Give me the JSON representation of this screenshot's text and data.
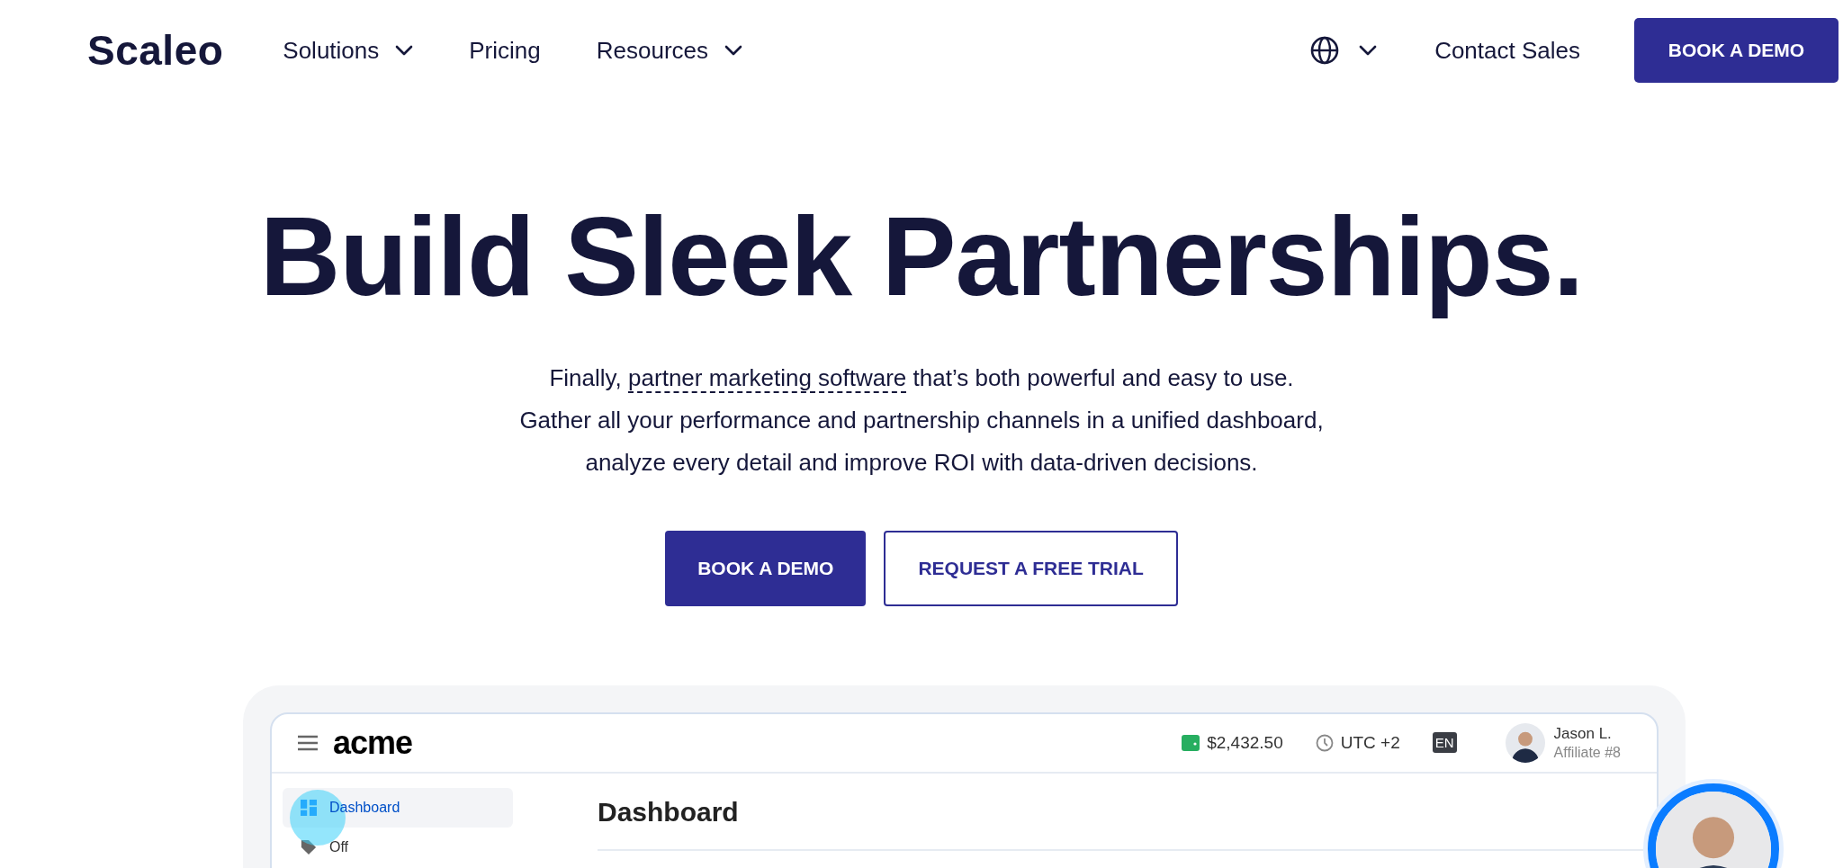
{
  "header": {
    "logo": "Scaleo",
    "nav": [
      {
        "label": "Solutions",
        "dropdown": true
      },
      {
        "label": "Pricing",
        "dropdown": false
      },
      {
        "label": "Resources",
        "dropdown": true
      }
    ],
    "contact": "Contact Sales",
    "cta": "BOOK A DEMO"
  },
  "hero": {
    "title": "Build Sleek Partnerships.",
    "subtitle": {
      "lead": "Finally, ",
      "link": "partner marketing software",
      "rest": " that’s both powerful and easy to use.",
      "lines": [
        "Gather all your performance and partnership channels in a unified dashboard,",
        "analyze every detail and improve ROI with data-driven decisions."
      ]
    },
    "buttons": [
      {
        "label": "BOOK A DEMO",
        "kind": "primary"
      },
      {
        "label": "REQUEST A FREE TRIAL",
        "kind": "outline"
      }
    ]
  },
  "dashboard": {
    "logo": "acme",
    "balance": "$2,432.50",
    "timezone": "UTC +2",
    "language": "EN",
    "user": {
      "name": "Jason L.",
      "role": "Affiliate #8"
    },
    "sidebar": [
      {
        "label": "Dashboard",
        "selected": true
      },
      {
        "label": "Off",
        "selected": false
      }
    ],
    "title": "Dashboard"
  }
}
